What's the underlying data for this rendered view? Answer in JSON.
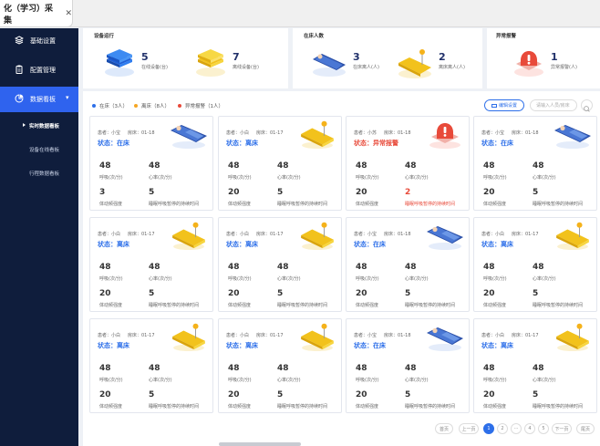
{
  "tab": {
    "title": "化（学习）采集"
  },
  "sidebar": {
    "items": [
      {
        "label": "基础设置"
      },
      {
        "label": "配置管理"
      },
      {
        "label": "数据看板"
      }
    ],
    "subs": [
      {
        "label": "实时数据看板"
      },
      {
        "label": "设备在线看板"
      },
      {
        "label": "行程数据看板"
      }
    ],
    "dropdown_arrow": "▾"
  },
  "top": {
    "card1": {
      "title": "设备运行",
      "badge": "",
      "online": {
        "num": "5",
        "label": "在线设备(台)"
      },
      "offline": {
        "num": "7",
        "label": "离线设备(台)"
      }
    },
    "card2": {
      "title": "在床人数",
      "badge": "",
      "inbed": {
        "num": "3",
        "label": "在床离人(人)"
      },
      "leave": {
        "num": "2",
        "label": "离床离人(人)"
      }
    },
    "card3": {
      "title": "异常报警",
      "alarm": {
        "num": "1",
        "label": "异常报警(人)"
      }
    }
  },
  "legend": [
    {
      "label": "在床（3人）",
      "color": "#2d6fe9"
    },
    {
      "label": "离床（8人）",
      "color": "#f5a623"
    },
    {
      "label": "异常报警（1人）",
      "color": "#e84a3a"
    }
  ],
  "toolbar": {
    "edit": "编辑设置",
    "search_placeholder": "请输入人员/房床"
  },
  "cards": [
    {
      "name": "患者：小宝",
      "bed": "房床：01-18",
      "status": "状态：在床",
      "state": "bed",
      "a": "48",
      "al": "呼吸(次/分)",
      "b": "48",
      "bl": "心率(次/分)",
      "c": "3",
      "cl": "体动频强度",
      "d": "5",
      "dl": "睡眠呼吸暂停的持续时间",
      "dred": false
    },
    {
      "name": "患者：小白",
      "bed": "房床：01-17",
      "status": "状态：离床",
      "state": "leave",
      "a": "48",
      "al": "呼吸(次/分)",
      "b": "48",
      "bl": "心率(次/分)",
      "c": "20",
      "cl": "体动频强度",
      "d": "5",
      "dl": "睡眠呼吸暂停的持续时间",
      "dred": false
    },
    {
      "name": "患者：小苏",
      "bed": "房床：01-18",
      "status": "状态：异常报警",
      "state": "alarm",
      "a": "48",
      "al": "呼吸(次/分)",
      "b": "48",
      "bl": "心率(次/分)",
      "c": "20",
      "cl": "体动频强度",
      "d": "2",
      "dl": "睡眠呼吸暂停的持续时间",
      "dred": true
    },
    {
      "name": "患者：小宝",
      "bed": "房床：01-18",
      "status": "状态：在床",
      "state": "bed",
      "a": "48",
      "al": "呼吸(次/分)",
      "b": "48",
      "bl": "心率(次/分)",
      "c": "20",
      "cl": "体动频强度",
      "d": "5",
      "dl": "睡眠呼吸暂停的持续时间",
      "dred": false
    },
    {
      "name": "患者：小白",
      "bed": "房床：01-17",
      "status": "状态：离床",
      "state": "leave",
      "a": "48",
      "al": "呼吸(次/分)",
      "b": "48",
      "bl": "心率(次/分)",
      "c": "20",
      "cl": "体动频强度",
      "d": "5",
      "dl": "睡眠呼吸暂停的持续时间",
      "dred": false
    },
    {
      "name": "患者：小白",
      "bed": "房床：01-17",
      "status": "状态：离床",
      "state": "leave",
      "a": "48",
      "al": "呼吸(次/分)",
      "b": "48",
      "bl": "心率(次/分)",
      "c": "20",
      "cl": "体动频强度",
      "d": "5",
      "dl": "睡眠呼吸暂停的持续时间",
      "dred": false
    },
    {
      "name": "患者：小宝",
      "bed": "房床：01-18",
      "status": "状态：在床",
      "state": "bed",
      "a": "48",
      "al": "呼吸(次/分)",
      "b": "48",
      "bl": "心率(次/分)",
      "c": "20",
      "cl": "体动频强度",
      "d": "5",
      "dl": "睡眠呼吸暂停的持续时间",
      "dred": false
    },
    {
      "name": "患者：小白",
      "bed": "房床：01-17",
      "status": "状态：离床",
      "state": "leave",
      "a": "48",
      "al": "呼吸(次/分)",
      "b": "48",
      "bl": "心率(次/分)",
      "c": "20",
      "cl": "体动频强度",
      "d": "5",
      "dl": "睡眠呼吸暂停的持续时间",
      "dred": false
    },
    {
      "name": "患者：小白",
      "bed": "房床：01-17",
      "status": "状态：离床",
      "state": "leave",
      "a": "48",
      "al": "呼吸(次/分)",
      "b": "48",
      "bl": "心率(次/分)",
      "c": "20",
      "cl": "体动频强度",
      "d": "5",
      "dl": "睡眠呼吸暂停的持续时间",
      "dred": false
    },
    {
      "name": "患者：小白",
      "bed": "房床：01-17",
      "status": "状态：离床",
      "state": "leave",
      "a": "48",
      "al": "呼吸(次/分)",
      "b": "48",
      "bl": "心率(次/分)",
      "c": "20",
      "cl": "体动频强度",
      "d": "5",
      "dl": "睡眠呼吸暂停的持续时间",
      "dred": false
    },
    {
      "name": "患者：小宝",
      "bed": "房床：01-18",
      "status": "状态：在床",
      "state": "bed",
      "a": "48",
      "al": "呼吸(次/分)",
      "b": "48",
      "bl": "心率(次/分)",
      "c": "20",
      "cl": "体动频强度",
      "d": "5",
      "dl": "睡眠呼吸暂停的持续时间",
      "dred": false
    },
    {
      "name": "患者：小白",
      "bed": "房床：01-17",
      "status": "状态：离床",
      "state": "leave",
      "a": "48",
      "al": "呼吸(次/分)",
      "b": "48",
      "bl": "心率(次/分)",
      "c": "20",
      "cl": "体动频强度",
      "d": "5",
      "dl": "睡眠呼吸暂停的持续时间",
      "dred": false
    }
  ],
  "pager": {
    "first": "首页",
    "prev": "上一页",
    "next": "下一页",
    "last": "尾页",
    "p1": "1",
    "p2": "2",
    "ellipsis": "···",
    "p4": "4",
    "p5": "5"
  },
  "colors": {
    "accent": "#2d6fe9",
    "sidebar": "#0f1d3c",
    "alarm": "#e84a3a",
    "leave": "#f5c62e"
  }
}
